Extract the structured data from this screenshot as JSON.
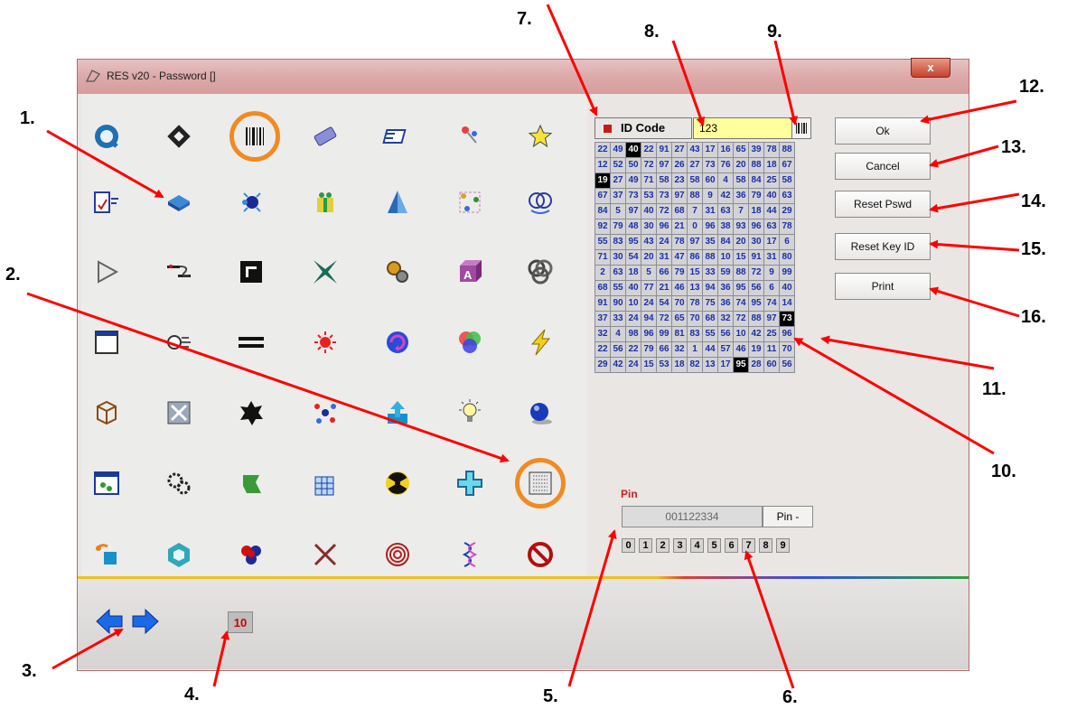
{
  "window": {
    "title": "RES v20 - Password []",
    "close_label": "x"
  },
  "icons": [
    [
      "quick-icon",
      "diamond-arrows-icon",
      "barcode-icon",
      "tag-icon",
      "card-reader-icon",
      "pushpin-icon",
      "star-icon"
    ],
    [
      "checklist-icon",
      "chip-icon",
      "bug-icon",
      "gift-icon",
      "pyramid-icon",
      "network-icon",
      "sync-icon"
    ],
    [
      "play-icon",
      "plug-icon",
      "square-frame-icon",
      "compass-star-icon",
      "gears-icon",
      "alphabet-block-icon",
      "knot-icon"
    ],
    [
      "window-icon",
      "speaker-icon",
      "equals-icon",
      "target-icon",
      "refresh-icon",
      "color-circles-icon",
      "lightning-icon"
    ],
    [
      "molecule-icon",
      "puzzle-icon",
      "blob-icon",
      "atom-icon",
      "upload-icon",
      "lightbulb-icon",
      "sphere-icon"
    ],
    [
      "web-window-icon",
      "cog-group-icon",
      "green-arrow-icon",
      "cube-grid-icon",
      "radiation-icon",
      "medical-cross-icon",
      "grid-pad-icon"
    ],
    [
      "share-icon",
      "hex-cube-icon",
      "cluster-icon",
      "x-mark-icon",
      "spiral-icon",
      "dna-icon",
      "no-entry-icon"
    ]
  ],
  "navigation": {
    "back_icon": "arrow-left-icon",
    "forward_icon": "arrow-right-icon",
    "page_number": "10"
  },
  "id_code": {
    "label": "ID Code",
    "value": "123",
    "barcode_icon": "barcode-icon"
  },
  "grid": [
    [
      "22",
      "49",
      "40",
      "22",
      "91",
      "27",
      "43",
      "17",
      "16",
      "65",
      "39",
      "78",
      "88"
    ],
    [
      "12",
      "52",
      "50",
      "72",
      "97",
      "26",
      "27",
      "73",
      "76",
      "20",
      "88",
      "18",
      "67"
    ],
    [
      "19",
      "27",
      "49",
      "71",
      "58",
      "23",
      "58",
      "60",
      "4",
      "58",
      "84",
      "25",
      "58"
    ],
    [
      "67",
      "37",
      "73",
      "53",
      "73",
      "97",
      "88",
      "9",
      "42",
      "36",
      "79",
      "40",
      "63"
    ],
    [
      "84",
      "5",
      "97",
      "40",
      "72",
      "68",
      "7",
      "31",
      "63",
      "7",
      "18",
      "44",
      "29"
    ],
    [
      "92",
      "79",
      "48",
      "30",
      "96",
      "21",
      "0",
      "96",
      "38",
      "93",
      "96",
      "63",
      "78"
    ],
    [
      "55",
      "83",
      "95",
      "43",
      "24",
      "78",
      "97",
      "35",
      "84",
      "20",
      "30",
      "17",
      "6"
    ],
    [
      "71",
      "30",
      "54",
      "20",
      "31",
      "47",
      "86",
      "88",
      "10",
      "15",
      "91",
      "31",
      "80"
    ],
    [
      "2",
      "63",
      "18",
      "5",
      "66",
      "79",
      "15",
      "33",
      "59",
      "88",
      "72",
      "9",
      "99"
    ],
    [
      "68",
      "55",
      "40",
      "77",
      "21",
      "46",
      "13",
      "94",
      "36",
      "95",
      "56",
      "6",
      "40"
    ],
    [
      "91",
      "90",
      "10",
      "24",
      "54",
      "70",
      "78",
      "75",
      "36",
      "74",
      "95",
      "74",
      "14"
    ],
    [
      "37",
      "33",
      "24",
      "94",
      "72",
      "65",
      "70",
      "68",
      "32",
      "72",
      "88",
      "97",
      "73"
    ],
    [
      "32",
      "4",
      "98",
      "96",
      "99",
      "81",
      "83",
      "55",
      "56",
      "10",
      "42",
      "25",
      "96"
    ],
    [
      "22",
      "56",
      "22",
      "79",
      "66",
      "32",
      "1",
      "44",
      "57",
      "46",
      "19",
      "11",
      "70"
    ],
    [
      "29",
      "42",
      "24",
      "15",
      "53",
      "18",
      "82",
      "13",
      "17",
      "95",
      "28",
      "60",
      "56"
    ]
  ],
  "grid_highlights": [
    [
      0,
      2
    ],
    [
      2,
      0
    ],
    [
      11,
      12
    ],
    [
      14,
      9
    ]
  ],
  "buttons": {
    "ok": "Ok",
    "cancel": "Cancel",
    "reset_pswd": "Reset Pswd",
    "reset_key_id": "Reset Key ID",
    "print": "Print"
  },
  "pin": {
    "label": "Pin",
    "value": "001122334",
    "button": "Pin -",
    "digits": [
      "0",
      "1",
      "2",
      "3",
      "4",
      "5",
      "6",
      "7",
      "8",
      "9"
    ]
  },
  "callouts": [
    "1.",
    "2.",
    "3.",
    "4.",
    "5.",
    "6.",
    "7.",
    "8.",
    "9.",
    "10.",
    "11.",
    "12.",
    "13.",
    "14.",
    "15.",
    "16."
  ],
  "colors": {
    "accent_red": "#ff0000",
    "highlight_orange": "#f08a22",
    "id_field_yellow": "#ffff9c",
    "grid_text_blue": "#1a2ea8"
  }
}
